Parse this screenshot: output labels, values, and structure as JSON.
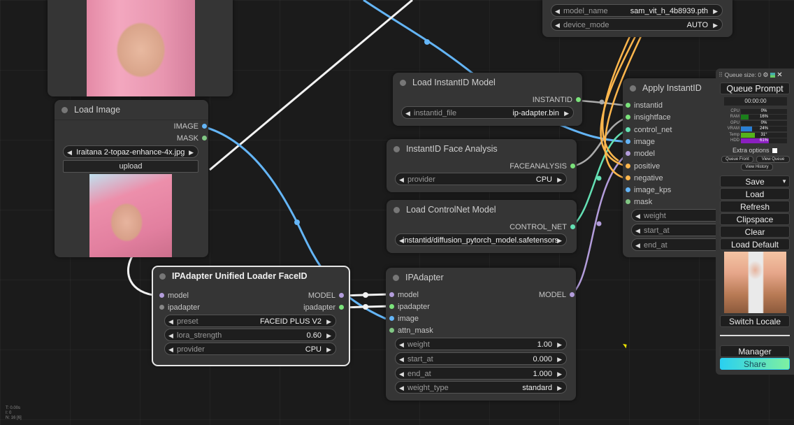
{
  "sam_loader": {
    "widgets": [
      {
        "label": "model_name",
        "value": "sam_vit_h_4b8939.pth"
      },
      {
        "label": "device_mode",
        "value": "AUTO"
      }
    ]
  },
  "load_image": {
    "title": "Load Image",
    "outputs": [
      "IMAGE",
      "MASK"
    ],
    "file_widget": {
      "value": "Iraitana 2-topaz-enhance-4x.jpg"
    },
    "upload_label": "upload"
  },
  "ipadapter_unified_loader": {
    "title": "IPAdapter Unified Loader FaceID",
    "inputs": [
      "model",
      "ipadapter"
    ],
    "outputs": [
      "MODEL",
      "ipadapter"
    ],
    "widgets": [
      {
        "label": "preset",
        "value": "FACEID PLUS V2"
      },
      {
        "label": "lora_strength",
        "value": "0.60"
      },
      {
        "label": "provider",
        "value": "CPU"
      }
    ]
  },
  "load_instantid_model": {
    "title": "Load InstantID Model",
    "outputs": [
      "INSTANTID"
    ],
    "widgets": [
      {
        "label": "instantid_file",
        "value": "ip-adapter.bin"
      }
    ]
  },
  "instantid_face_analysis": {
    "title": "InstantID Face Analysis",
    "outputs": [
      "FACEANALYSIS"
    ],
    "widgets": [
      {
        "label": "provider",
        "value": "CPU"
      }
    ]
  },
  "load_controlnet": {
    "title": "Load ControlNet Model",
    "outputs": [
      "CONTROL_NET"
    ],
    "widgets": [
      {
        "label": "",
        "value": "instantid/diffusion_pytorch_model.safetensors"
      }
    ]
  },
  "ipadapter": {
    "title": "IPAdapter",
    "inputs": [
      "model",
      "ipadapter",
      "image",
      "attn_mask"
    ],
    "outputs": [
      "MODEL"
    ],
    "widgets": [
      {
        "label": "weight",
        "value": "1.00"
      },
      {
        "label": "start_at",
        "value": "0.000"
      },
      {
        "label": "end_at",
        "value": "1.000"
      },
      {
        "label": "weight_type",
        "value": "standard"
      }
    ]
  },
  "apply_instantid": {
    "title": "Apply InstantID",
    "inputs": [
      "instantid",
      "insightface",
      "control_net",
      "image",
      "model",
      "positive",
      "negative",
      "image_kps",
      "mask"
    ],
    "widgets": [
      {
        "label": "weight"
      },
      {
        "label": "start_at"
      },
      {
        "label": "end_at"
      }
    ]
  },
  "panel": {
    "queue_size_label": "Queue size: 0",
    "queue_prompt": "Queue Prompt",
    "timer": "00:00:00",
    "stats": [
      {
        "label": "CPU",
        "value": "0%",
        "fill": 0,
        "color": "#1a7f1a"
      },
      {
        "label": "RAM",
        "value": "16%",
        "fill": 0.16,
        "color": "#1a7f1a"
      },
      {
        "label": "GPU",
        "value": "0%",
        "fill": 0,
        "color": "#1a7f1a"
      },
      {
        "label": "VRAM",
        "value": "24%",
        "fill": 0.24,
        "color": "#2a7fd4"
      },
      {
        "label": "Temp",
        "value": "31°",
        "fill": 0.31,
        "color": "#55b31a"
      },
      {
        "label": "HDD",
        "value": "61%",
        "fill": 0.61,
        "color": "#8a1fc0"
      }
    ],
    "extra_options": "Extra options",
    "queue_front": "Queue Front",
    "view_queue": "View Queue",
    "view_history": "View History",
    "buttons": [
      "Save",
      "Load",
      "Refresh",
      "Clipspace",
      "Clear",
      "Load Default"
    ],
    "switch_locale": "Switch Locale",
    "manager": "Manager",
    "share": "Share"
  },
  "footer_stats": [
    "T: 0.00s",
    "I: 0",
    "N: 16 [6]"
  ],
  "colors": {
    "model": "#b39ddb",
    "image": "#64b5f6",
    "green": "#7be37b",
    "mask": "#81c784",
    "control_net": "#64e0b4",
    "conditioning": "#ffb74d",
    "grey": "#888888"
  }
}
